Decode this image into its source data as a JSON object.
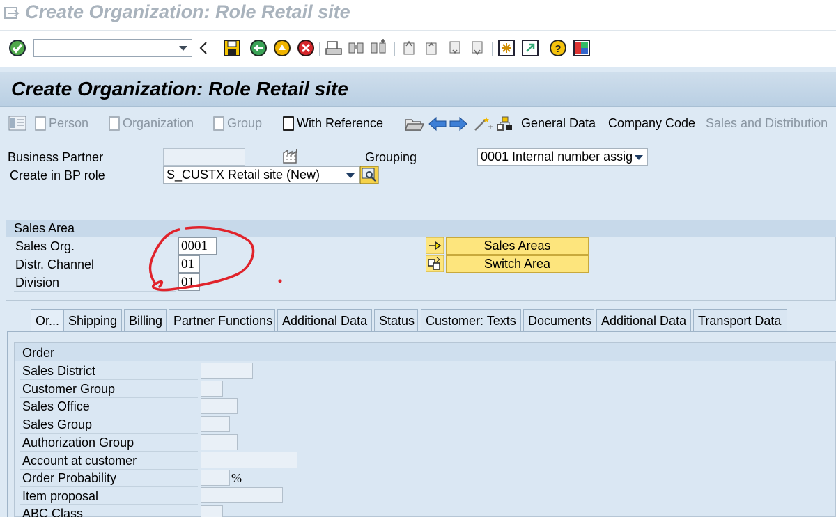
{
  "window": {
    "title": "Create Organization: Role Retail site"
  },
  "page": {
    "title": "Create Organization: Role Retail site"
  },
  "system_toolbar": {
    "command_placeholder": ""
  },
  "app_toolbar": {
    "person": "Person",
    "organization": "Organization",
    "group": "Group",
    "with_reference": "With Reference",
    "general_data": "General Data",
    "company_code": "Company Code",
    "sales_distribution": "Sales and Distribution"
  },
  "header": {
    "business_partner_label": "Business Partner",
    "business_partner_value": "",
    "grouping_label": "Grouping",
    "grouping_value": "0001 Internal number assig",
    "bp_role_label": "Create in BP role",
    "bp_role_value": "S_CUSTX Retail site (New)"
  },
  "sales_area": {
    "title": "Sales Area",
    "sales_org_label": "Sales Org.",
    "sales_org_value": "0001",
    "distr_channel_label": "Distr. Channel",
    "distr_channel_value": "01",
    "division_label": "Division",
    "division_value": "01",
    "sales_areas_button": "Sales Areas",
    "switch_area_button": "Switch Area"
  },
  "tabs": [
    "Or...",
    "Shipping",
    "Billing",
    "Partner Functions",
    "Additional Data",
    "Status",
    "Customer: Texts",
    "Documents",
    "Additional Data",
    "Transport Data"
  ],
  "order": {
    "title": "Order",
    "fields": [
      {
        "label": "Sales District",
        "value": ""
      },
      {
        "label": "Customer Group",
        "value": ""
      },
      {
        "label": "Sales Office",
        "value": ""
      },
      {
        "label": "Sales Group",
        "value": ""
      },
      {
        "label": "Authorization Group",
        "value": ""
      },
      {
        "label": "Account at customer",
        "value": ""
      },
      {
        "label": "Order Probability",
        "value": "",
        "unit": "%"
      },
      {
        "label": "Item proposal",
        "value": ""
      },
      {
        "label": "ABC Class",
        "value": ""
      }
    ]
  },
  "colors": {
    "annotation": "#e0232b",
    "button_yellow": "#fde57d",
    "background": "#dde9f4"
  }
}
